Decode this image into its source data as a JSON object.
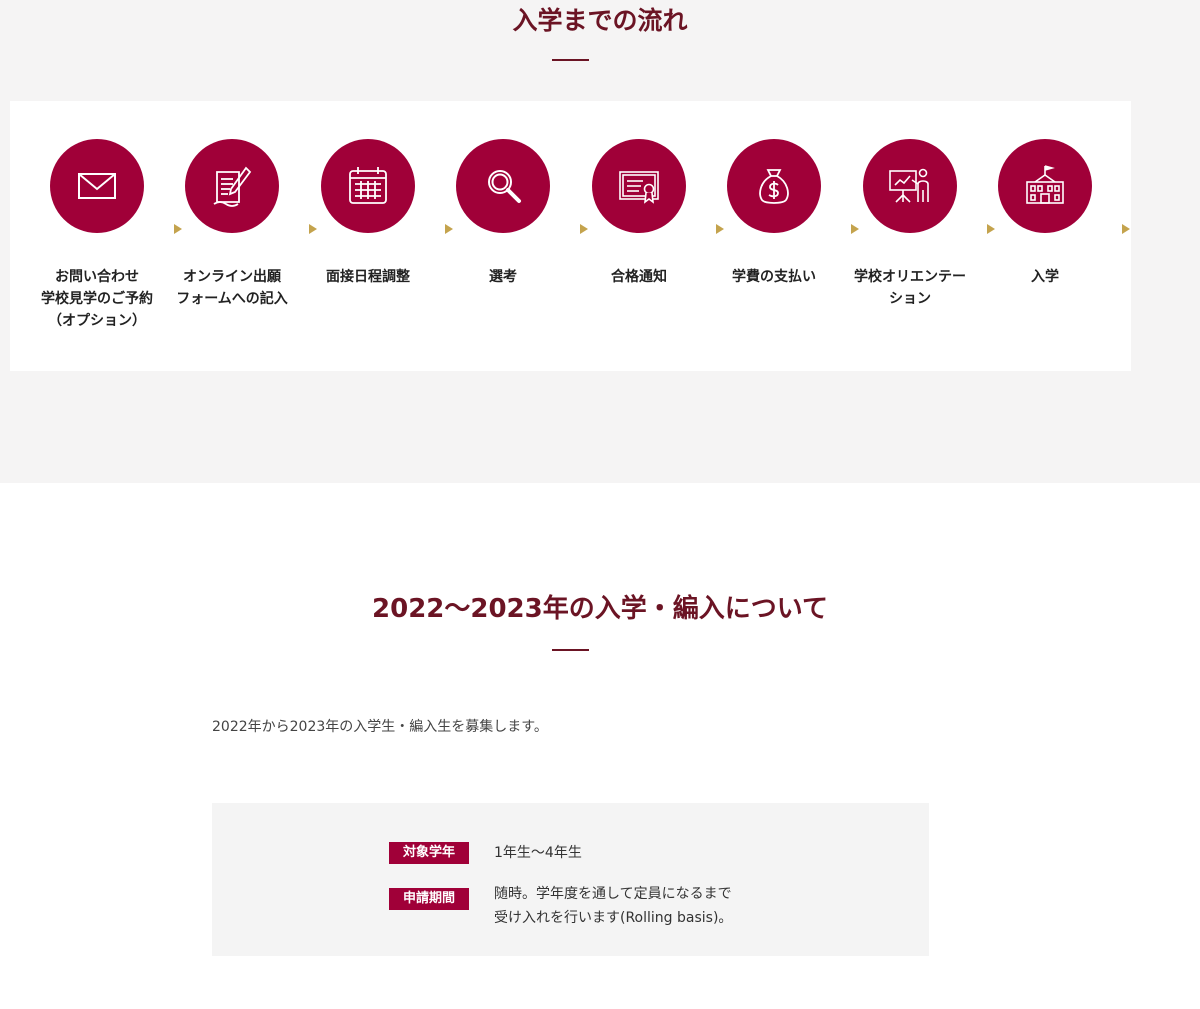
{
  "flow": {
    "title": "入学までの流れ",
    "steps": [
      {
        "label": "お問い合わせ\n学校見学のご予約\n（オプション）",
        "icon": "envelope-icon"
      },
      {
        "label": "オンライン出願\nフォームへの記入",
        "icon": "document-pen-icon"
      },
      {
        "label": "面接日程調整",
        "icon": "calendar-icon"
      },
      {
        "label": "選考",
        "icon": "magnifier-icon"
      },
      {
        "label": "合格通知",
        "icon": "certificate-icon"
      },
      {
        "label": "学費の支払い",
        "icon": "money-bag-icon"
      },
      {
        "label": "学校オリエンテー\nション",
        "icon": "presentation-icon"
      },
      {
        "label": "入学",
        "icon": "school-building-icon"
      }
    ]
  },
  "admission": {
    "title": "2022〜2023年の入学・編入について",
    "intro": "2022年から2023年の入学生・編入生を募集します。",
    "info": [
      {
        "tag": "対象学年",
        "value": "1年生〜4年生"
      },
      {
        "tag": "申請期間",
        "value": "随時。学年度を通して定員になるまで\n受け入れを行います(Rolling basis)。"
      }
    ]
  },
  "colors": {
    "brand": "#a00038",
    "title": "#6b1424",
    "arrow": "#c4a34d",
    "section_bg": "#f5f4f4"
  }
}
